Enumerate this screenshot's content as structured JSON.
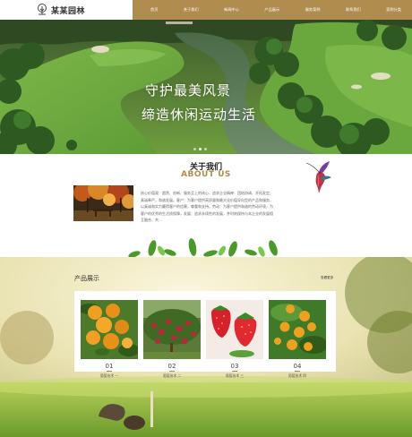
{
  "header": {
    "logo_text": "某某园林",
    "nav": [
      "首页",
      "关于我们",
      "新闻中心",
      "产品展示",
      "服务案例",
      "联系我们",
      "案例分类"
    ]
  },
  "hero": {
    "title": "守护最美风景",
    "subtitle": "缔造休闲运动生活",
    "slides": 3,
    "active_slide": 2
  },
  "about": {
    "title_cn": "关于我们",
    "title_en": "ABOUT US",
    "body": "核心价值观：超然、创新、服务至上的核心，追求企业精神：团结协调、开拓发定、真诚奉严，和谐发展。客户：为客户提供高质量和最大化价值导向型的产品和服务，以真诚和实力赢得客户的信赖，尊重和支持。劳动：为客户提供和谐的劳动环境，为客户的优秀的生活质保障，发展：追求永续性的发展，并时刻保持与本企业的发展相互融合，共..."
  },
  "products": {
    "title": "产品展示",
    "more": "查看更多",
    "items": [
      {
        "num": "01",
        "name": "葡萄技术 一"
      },
      {
        "num": "02",
        "name": "葡萄技术 二"
      },
      {
        "num": "03",
        "name": "葡萄技术 三"
      },
      {
        "num": "04",
        "name": "葡萄技术 四"
      }
    ]
  },
  "colors": {
    "accent": "#b08c4e",
    "grass": "#5f9a3a"
  },
  "icons": [
    "logo-tree-icon",
    "bird-illustration",
    "leaves-decoration"
  ]
}
